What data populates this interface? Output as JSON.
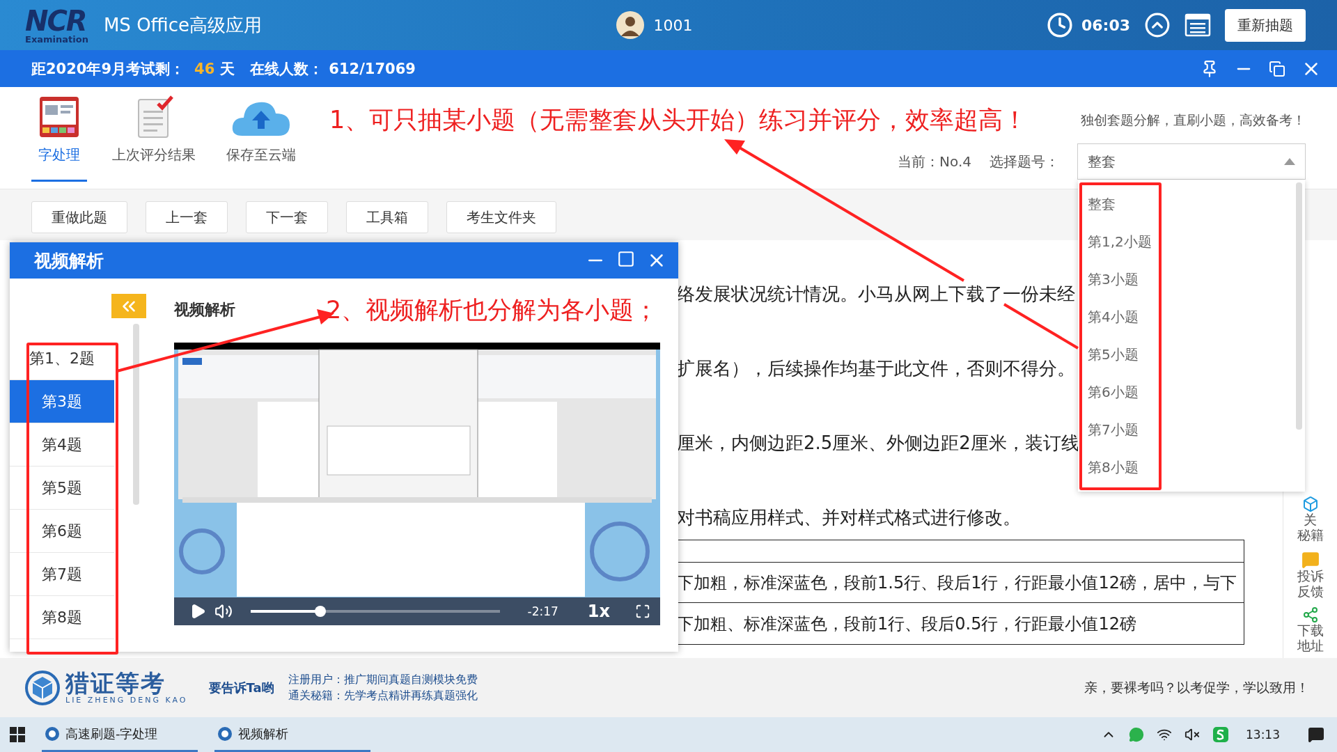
{
  "app_header": {
    "logo_mark": "NCR",
    "logo_sub": "Examination",
    "title": "MS Office高级应用",
    "user": "1001",
    "timer": "06:03",
    "redraw_button": "重新抽题"
  },
  "info_bar": {
    "countdown_label": "距2020年9月考试剩：",
    "days": "46",
    "days_unit": "天",
    "online_label": "在线人数：",
    "online": "612/17069"
  },
  "modules": [
    {
      "kind": "word",
      "label": "字处理",
      "selected": true
    },
    {
      "kind": "result",
      "label": "上次评分结果",
      "selected": false
    },
    {
      "kind": "cloud",
      "label": "保存至云端",
      "selected": false
    }
  ],
  "annotation_1": "1、可只抽某小题（无需整套从头开始）练习并评分，效率超高！",
  "slogan": "独创套题分解，直刷小题，高效备考！",
  "current": "当前：No.4",
  "select_label": "选择题号：",
  "select_value": "整套",
  "dropdown_options": [
    "整套",
    "第1,2小题",
    "第3小题",
    "第4小题",
    "第5小题",
    "第6小题",
    "第7小题",
    "第8小题"
  ],
  "actions": [
    "重做此题",
    "上一套",
    "下一套",
    "工具箱",
    "考生文件夹"
  ],
  "content_lines": [
    "络发展状况统计情况。小马从网上下载了一份未经",
    "扩展名），后续操作均基于此文件，否则不得分。",
    "厘米，内侧边距2.5厘米、外侧边距2厘米，装订线",
    "对书稿应用样式、并对样式格式进行修改。"
  ],
  "table_rows": [
    "",
    "下加粗，标准深蓝色，段前1.5行、段后1行，行距最小值12磅，居中，与下",
    "下加粗、标准深蓝色，段前1行、段后0.5行，行距最小值12磅"
  ],
  "side_links": [
    {
      "kind": "cube",
      "lines": [
        "关",
        "秘籍"
      ]
    },
    {
      "kind": "chat",
      "lines": [
        "投诉",
        "反馈"
      ]
    },
    {
      "kind": "share",
      "lines": [
        "下载",
        "地址"
      ]
    }
  ],
  "video_window": {
    "title": "视频解析",
    "heading": "视频解析",
    "annotation_2": "2、视频解析也分解为各小题；",
    "questions": [
      {
        "label": "第1、2题",
        "selected": false
      },
      {
        "label": "第3题",
        "selected": true
      },
      {
        "label": "第4题",
        "selected": false
      },
      {
        "label": "第5题",
        "selected": false
      },
      {
        "label": "第6题",
        "selected": false
      },
      {
        "label": "第7题",
        "selected": false
      },
      {
        "label": "第8题",
        "selected": false
      }
    ],
    "player": {
      "level": 0.28,
      "time": "-2:17",
      "speed": "1x"
    }
  },
  "footer": {
    "brand": "猎证等考",
    "brand_sub": "LIE ZHENG DENG KAO",
    "tell": "要告诉Ta哟",
    "promos": [
      "注册用户：推广期间真题自测模块免费",
      "通关秘籍：先学考点精讲再练真题强化"
    ],
    "motto": "亲，要裸考吗？以考促学，学以致用！"
  },
  "taskbar": {
    "items": [
      "高速刷题-字处理",
      "视频解析"
    ],
    "clock": "13:13"
  }
}
